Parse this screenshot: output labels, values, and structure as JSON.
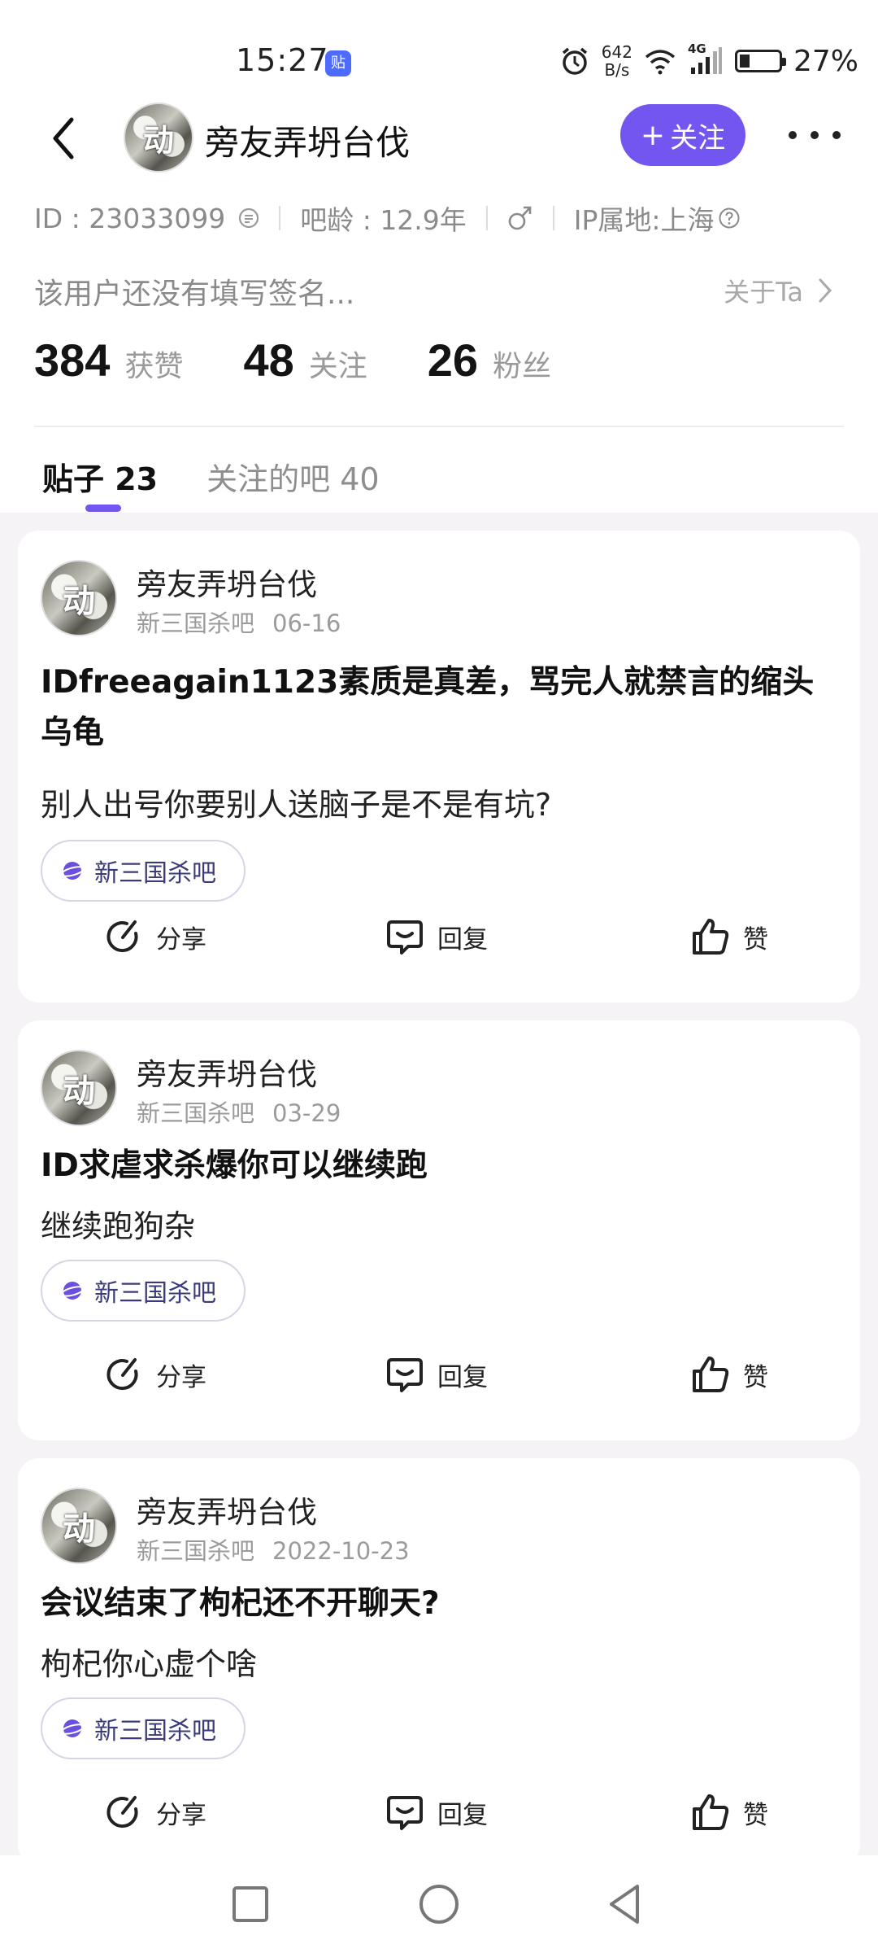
{
  "status_bar": {
    "time": "15:27",
    "app_icon_glyph": "贴",
    "net_speed_value": "642",
    "net_speed_unit": "B/s",
    "network_type": "4G",
    "battery_percent": "27%",
    "battery_level": 0.27
  },
  "header": {
    "username": "旁友弄坍台伐",
    "avatar_glyph": "动",
    "follow_plus": "+",
    "follow_label": "关注"
  },
  "profile": {
    "id_text": "ID : 23033099",
    "bar_age": "吧龄 : 12.9年",
    "ip_location": "IP属地:上海",
    "signature": "该用户还没有填写签名...",
    "about_link": "关于Ta",
    "stats": [
      {
        "value": "384",
        "label": "获赞"
      },
      {
        "value": "48",
        "label": "关注"
      },
      {
        "value": "26",
        "label": "粉丝"
      }
    ]
  },
  "tabs": [
    {
      "label": "贴子 23",
      "active": true
    },
    {
      "label": "关注的吧 40",
      "active": false
    }
  ],
  "actions": {
    "share": "分享",
    "reply": "回复",
    "like": "赞"
  },
  "posts": [
    {
      "author": "旁友弄坍台伐",
      "forum": "新三国杀吧",
      "date": "06-16",
      "title": "IDfreeagain1123素质是真差，骂完人就禁言的缩头乌龟",
      "body": "别人出号你要别人送脑子是不是有坑?",
      "forum_tag": "新三国杀吧"
    },
    {
      "author": "旁友弄坍台伐",
      "forum": "新三国杀吧",
      "date": "03-29",
      "title": "ID求虐求杀爆你可以继续跑",
      "body": "继续跑狗杂",
      "forum_tag": "新三国杀吧"
    },
    {
      "author": "旁友弄坍台伐",
      "forum": "新三国杀吧",
      "date": "2022-10-23",
      "title": "会议结束了枸杞还不开聊天?",
      "body": "枸杞你心虚个啥",
      "forum_tag": "新三国杀吧"
    }
  ],
  "colors": {
    "accent": "#7356f0",
    "feed_background": "#f6f3f7"
  }
}
